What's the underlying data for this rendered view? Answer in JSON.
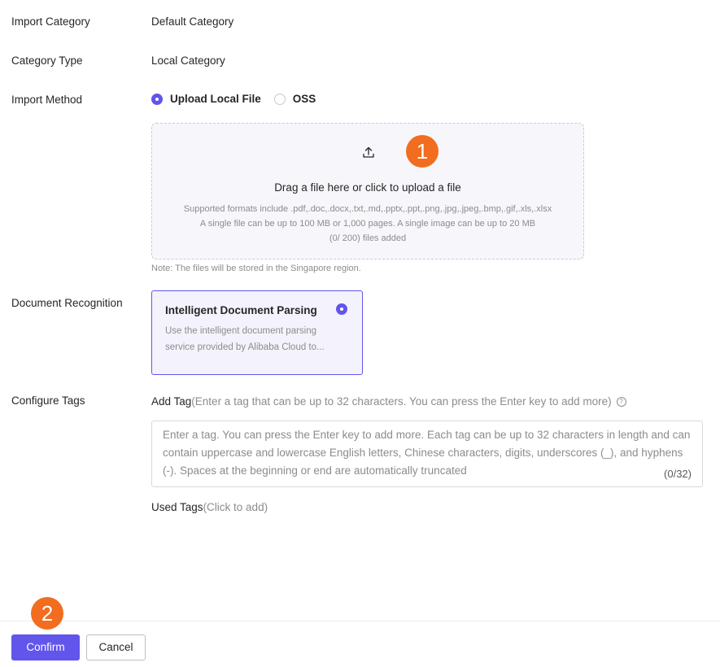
{
  "form": {
    "import_category": {
      "label": "Import Category",
      "value": "Default Category"
    },
    "category_type": {
      "label": "Category Type",
      "value": "Local Category"
    },
    "import_method": {
      "label": "Import Method",
      "options": [
        {
          "label": "Upload Local File",
          "checked": true
        },
        {
          "label": "OSS",
          "checked": false
        }
      ]
    },
    "upload": {
      "title": "Drag a file here or click to upload a file",
      "formats": "Supported formats include .pdf,.doc,.docx,.txt,.md,.pptx,.ppt,.png,.jpg,.jpeg,.bmp,.gif,.xls,.xlsx",
      "limits": "A single file can be up to 100 MB or 1,000 pages. A single image can be up to 20 MB",
      "count": "(0/ 200) files added",
      "note": "Note: The files will be stored in the Singapore region."
    },
    "document_recognition": {
      "label": "Document Recognition",
      "card_title": "Intelligent Document Parsing",
      "card_desc": "Use the intelligent document parsing service provided by Alibaba Cloud to..."
    },
    "tags": {
      "label": "Configure Tags",
      "add_tag": "Add Tag",
      "add_tag_hint": "(Enter a tag that can be up to 32 characters. You can press the Enter key to add more)",
      "placeholder": "Enter a tag. You can press the Enter key to add more. Each tag can be up to 32 characters in length and can contain uppercase and lowercase English letters, Chinese characters, digits, underscores (_), and hyphens (-). Spaces at the beginning or end are automatically truncated",
      "counter": "(0/32)",
      "used_tags": "Used Tags",
      "used_tags_hint": "(Click to add)"
    }
  },
  "annotations": {
    "step1": "1",
    "step2": "2"
  },
  "footer": {
    "confirm": "Confirm",
    "cancel": "Cancel"
  },
  "colors": {
    "primary": "#6155ec",
    "badge": "#f26d1f",
    "muted": "#8c8c8c"
  }
}
